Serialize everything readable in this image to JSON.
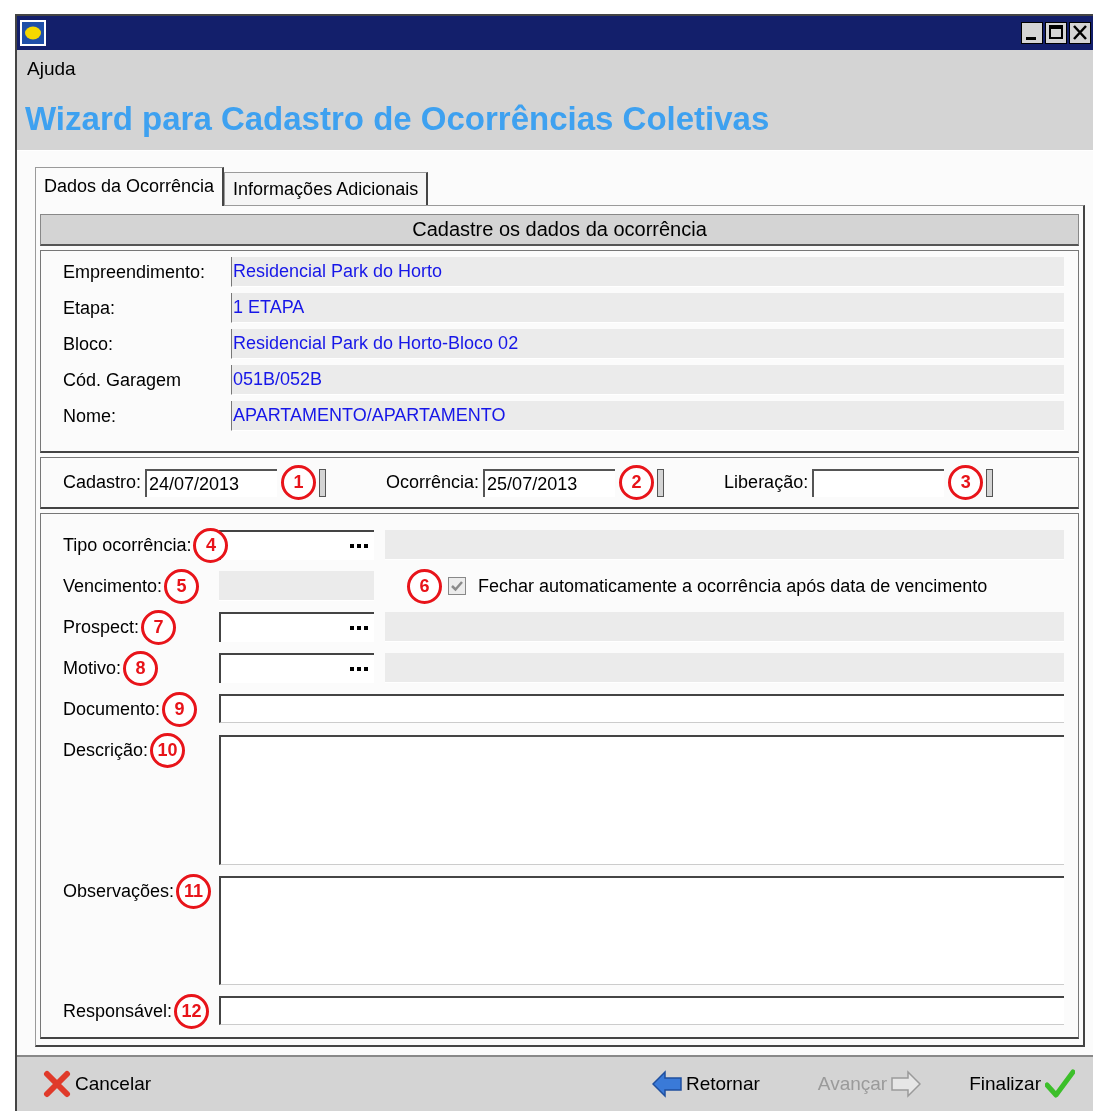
{
  "window": {
    "menu": [
      {
        "label": "Ajuda"
      }
    ],
    "heading": "Wizard para Cadastro de Ocorrências Coletivas"
  },
  "tabs": [
    {
      "label": "Dados da Ocorrência",
      "selected": true
    },
    {
      "label": "Informações Adicionais",
      "selected": false
    }
  ],
  "section_title": "Cadastre os dados da ocorrência",
  "info": [
    {
      "label": "Empreendimento:",
      "value": "Residencial Park do Horto"
    },
    {
      "label": "Etapa:",
      "value": "1 ETAPA"
    },
    {
      "label": "Bloco:",
      "value": "Residencial Park do Horto-Bloco 02"
    },
    {
      "label": "Cód. Garagem",
      "value": "051B/052B"
    },
    {
      "label": "Nome:",
      "value": "APARTAMENTO/APARTAMENTO"
    }
  ],
  "dates": [
    {
      "label": "Cadastro:",
      "value": "24/07/2013",
      "marker": "1"
    },
    {
      "label": "Ocorrência:",
      "value": "25/07/2013",
      "marker": "2"
    },
    {
      "label": "Liberação:",
      "marker": "3"
    }
  ],
  "fields": [
    {
      "kind": "lookup",
      "label": "Tipo ocorrência:",
      "marker": "4"
    },
    {
      "kind": "readonly",
      "label": "Vencimento:",
      "marker": "5",
      "checkbox": {
        "label": "Fechar automaticamente a ocorrência após data de vencimento",
        "marker": "6",
        "checked": true,
        "disabled": true
      }
    },
    {
      "kind": "lookup",
      "label": "Prospect:",
      "marker": "7"
    },
    {
      "kind": "lookup",
      "label": "Motivo:",
      "marker": "8"
    },
    {
      "kind": "text",
      "label": "Documento:",
      "marker": "9"
    },
    {
      "kind": "memo",
      "label": "Descrição:",
      "marker": "10"
    },
    {
      "kind": "memo",
      "label": "Observações:",
      "marker": "11"
    },
    {
      "kind": "text",
      "label": "Responsável:",
      "marker": "12"
    }
  ],
  "buttons": [
    {
      "kind": "cancel",
      "label": "Cancelar",
      "disabled": false
    },
    {
      "kind": "back",
      "label": "Retornar",
      "disabled": false
    },
    {
      "kind": "next",
      "label": "Avançar",
      "disabled": true
    },
    {
      "kind": "finish",
      "label": "Finalizar",
      "disabled": false
    }
  ]
}
